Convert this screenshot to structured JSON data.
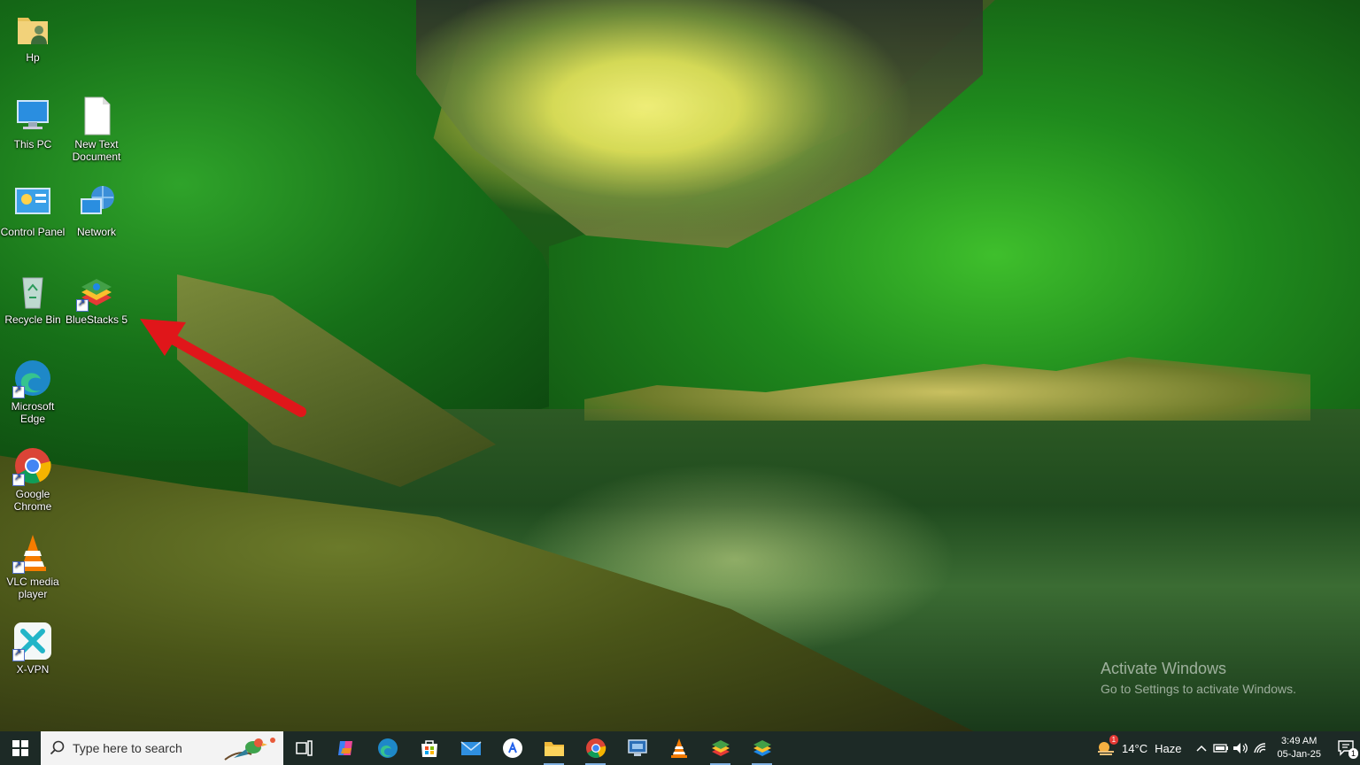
{
  "desktop": {
    "icons": [
      {
        "label": "Hp",
        "icon": "user-folder-icon"
      },
      {
        "label": "This PC",
        "icon": "computer-icon"
      },
      {
        "label": "New Text Document",
        "icon": "text-document-icon"
      },
      {
        "label": "Control Panel",
        "icon": "control-panel-icon"
      },
      {
        "label": "Network",
        "icon": "network-icon"
      },
      {
        "label": "Recycle Bin",
        "icon": "recycle-bin-icon"
      },
      {
        "label": "BlueStacks 5",
        "icon": "bluestacks-icon"
      },
      {
        "label": "Microsoft Edge",
        "icon": "edge-icon"
      },
      {
        "label": "Google Chrome",
        "icon": "chrome-icon"
      },
      {
        "label": "VLC media player",
        "icon": "vlc-icon"
      },
      {
        "label": "X-VPN",
        "icon": "xvpn-icon"
      }
    ],
    "watermark": {
      "title": "Activate Windows",
      "subtitle": "Go to Settings to activate Windows."
    },
    "annotation": "red-arrow-pointing-to-bluestacks"
  },
  "taskbar": {
    "search_placeholder": "Type here to search",
    "apps": [
      {
        "name": "task-view-icon"
      },
      {
        "name": "copilot-icon"
      },
      {
        "name": "edge-icon"
      },
      {
        "name": "microsoft-store-icon"
      },
      {
        "name": "mail-icon"
      },
      {
        "name": "app-store-icon"
      },
      {
        "name": "file-explorer-icon"
      },
      {
        "name": "chrome-icon"
      },
      {
        "name": "remote-desktop-icon"
      },
      {
        "name": "vlc-icon"
      },
      {
        "name": "bluestacks-icon"
      },
      {
        "name": "bluestacks-x-icon"
      }
    ],
    "weather": {
      "temp": "14°C",
      "condition": "Haze",
      "badge": "1"
    },
    "clock": {
      "time": "3:49 AM",
      "date": "05-Jan-25"
    },
    "notification_count": "1"
  },
  "colors": {
    "taskbar_bg": "#1d2a26",
    "arrow": "#e0161a",
    "accent": "#7fb0e0"
  }
}
